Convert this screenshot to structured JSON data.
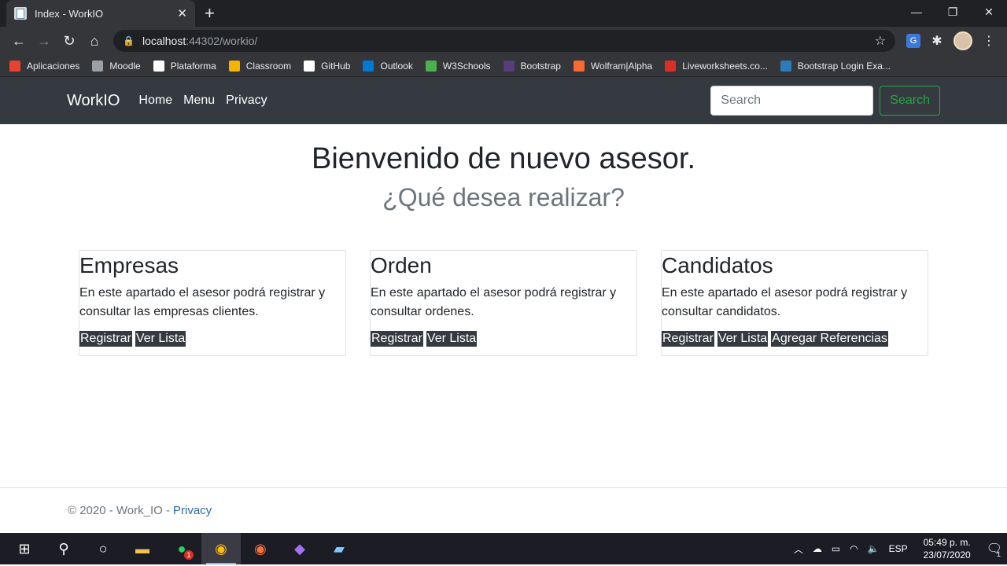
{
  "browser": {
    "tab_title": "Index - WorkIO",
    "url_host": "localhost",
    "url_path": ":44302/workio/",
    "bookmarks": [
      {
        "label": "Aplicaciones",
        "color": "#e94235"
      },
      {
        "label": "Moodle",
        "color": "#9aa0a6"
      },
      {
        "label": "Plataforma",
        "color": "#ffffff"
      },
      {
        "label": "Classroom",
        "color": "#f4b400"
      },
      {
        "label": "GitHub",
        "color": "#ffffff"
      },
      {
        "label": "Outlook",
        "color": "#0078d4"
      },
      {
        "label": "W3Schools",
        "color": "#4caf50"
      },
      {
        "label": "Bootstrap",
        "color": "#563d7c"
      },
      {
        "label": "Wolfram|Alpha",
        "color": "#f96932"
      },
      {
        "label": "Liveworksheets.co...",
        "color": "#d93025"
      },
      {
        "label": "Bootstrap Login Exa...",
        "color": "#2b7bb9"
      }
    ]
  },
  "navbar": {
    "brand": "WorkIO",
    "links": [
      "Home",
      "Menu",
      "Privacy"
    ],
    "search_placeholder": "Search",
    "search_button": "Search"
  },
  "main": {
    "title": "Bienvenido de nuevo asesor.",
    "subtitle": "¿Qué desea realizar?",
    "cards": [
      {
        "title": "Empresas",
        "text": "En este apartado el asesor podrá registrar y consultar las empresas clientes.",
        "buttons": [
          "Registrar",
          "Ver Lista"
        ]
      },
      {
        "title": "Orden",
        "text": "En este apartado el asesor podrá registrar y consultar ordenes.",
        "buttons": [
          "Registrar",
          "Ver Lista"
        ]
      },
      {
        "title": "Candidatos",
        "text": "En este apartado el asesor podrá registrar y consultar candidatos.",
        "buttons": [
          "Registrar",
          "Ver Lista",
          "Agregar Referencias"
        ]
      }
    ]
  },
  "footer": {
    "copyright": "© 2020 - Work_IO -",
    "privacy_link": "Privacy"
  },
  "taskbar": {
    "language": "ESP",
    "time": "05:49 p. m.",
    "date": "23/07/2020",
    "notification_count": "1",
    "whatsapp_badge": "1"
  }
}
